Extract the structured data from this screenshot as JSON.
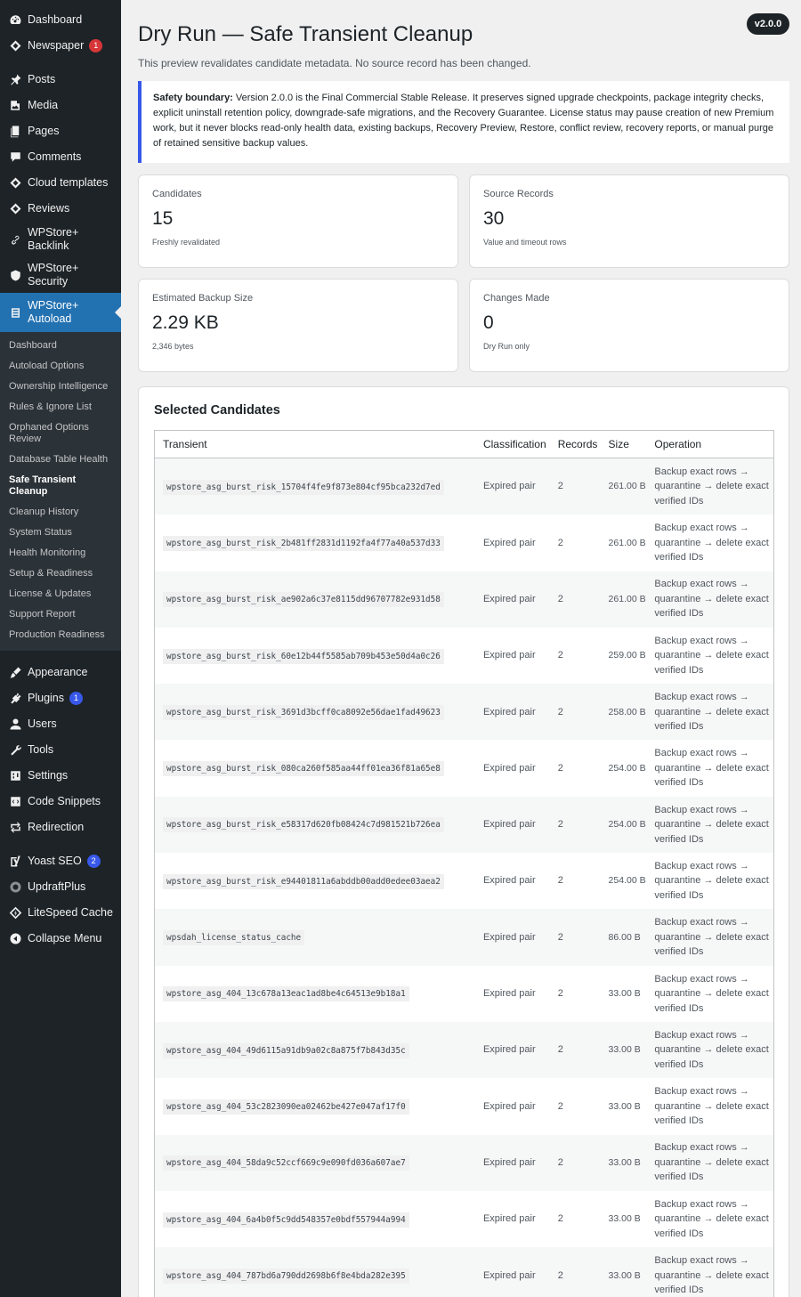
{
  "sidebar": {
    "top_items": [
      {
        "label": "Dashboard",
        "icon": "dashboard-icon"
      },
      {
        "label": "Newspaper",
        "icon": "newspaper-icon",
        "badge": "1"
      }
    ],
    "items": [
      {
        "label": "Posts",
        "icon": "pin-icon"
      },
      {
        "label": "Media",
        "icon": "media-icon"
      },
      {
        "label": "Pages",
        "icon": "pages-icon"
      },
      {
        "label": "Comments",
        "icon": "comments-icon"
      },
      {
        "label": "Cloud templates",
        "icon": "diamond-icon"
      },
      {
        "label": "Reviews",
        "icon": "diamond-icon"
      },
      {
        "label": "WPStore+ Backlink",
        "icon": "link-icon"
      },
      {
        "label": "WPStore+ Security",
        "icon": "shield-icon"
      }
    ],
    "active_item": {
      "label": "WPStore+ Autoload",
      "icon": "database-icon"
    },
    "submenu": [
      "Dashboard",
      "Autoload Options",
      "Ownership Intelligence",
      "Rules & Ignore List",
      "Orphaned Options Review",
      "Database Table Health",
      "Safe Transient Cleanup",
      "Cleanup History",
      "System Status",
      "Health Monitoring",
      "Setup & Readiness",
      "License & Updates",
      "Support Report",
      "Production Readiness"
    ],
    "current_submenu": "Safe Transient Cleanup",
    "bottom_items": [
      {
        "label": "Appearance",
        "icon": "brush-icon"
      },
      {
        "label": "Plugins",
        "icon": "plugin-icon",
        "badge": "1"
      },
      {
        "label": "Users",
        "icon": "user-icon"
      },
      {
        "label": "Tools",
        "icon": "wrench-icon"
      },
      {
        "label": "Settings",
        "icon": "settings-icon"
      },
      {
        "label": "Code Snippets",
        "icon": "code-icon"
      },
      {
        "label": "Redirection",
        "icon": "redirect-icon"
      },
      {
        "label": "Yoast SEO",
        "icon": "yoast-icon",
        "badge": "2"
      },
      {
        "label": "UpdraftPlus",
        "icon": "updraft-icon"
      },
      {
        "label": "LiteSpeed Cache",
        "icon": "litespeed-icon"
      },
      {
        "label": "Collapse Menu",
        "icon": "collapse-icon"
      }
    ]
  },
  "header": {
    "title": "Dry Run — Safe Transient Cleanup",
    "subtitle": "This preview revalidates candidate metadata. No source record has been changed.",
    "version": "v2.0.0"
  },
  "notice": {
    "bold": "Safety boundary:",
    "text": " Version 2.0.0 is the Final Commercial Stable Release. It preserves signed upgrade checkpoints, package integrity checks, explicit uninstall retention policy, downgrade-safe migrations, and the Recovery Guarantee. License status may pause creation of new Premium work, but it never blocks read-only health data, existing backups, Recovery Preview, Restore, conflict review, recovery reports, or manual purge of retained sensitive backup values."
  },
  "stats": [
    {
      "label": "Candidates",
      "value": "15",
      "note": "Freshly revalidated"
    },
    {
      "label": "Source Records",
      "value": "30",
      "note": "Value and timeout rows"
    },
    {
      "label": "Estimated Backup Size",
      "value": "2.29 KB",
      "note": "2,346 bytes"
    },
    {
      "label": "Changes Made",
      "value": "0",
      "note": "Dry Run only"
    }
  ],
  "table": {
    "title": "Selected Candidates",
    "columns": [
      "Transient",
      "Classification",
      "Records",
      "Size",
      "Operation"
    ],
    "rows": [
      {
        "transient": "wpstore_asg_burst_risk_15704f4fe9f873e804cf95bca232d7ed",
        "classification": "Expired pair",
        "records": "2",
        "size": "261.00 B",
        "operation": "Backup exact rows → quarantine → delete exact verified IDs"
      },
      {
        "transient": "wpstore_asg_burst_risk_2b481ff2831d1192fa4f77a40a537d33",
        "classification": "Expired pair",
        "records": "2",
        "size": "261.00 B",
        "operation": "Backup exact rows → quarantine → delete exact verified IDs"
      },
      {
        "transient": "wpstore_asg_burst_risk_ae902a6c37e8115dd96707782e931d58",
        "classification": "Expired pair",
        "records": "2",
        "size": "261.00 B",
        "operation": "Backup exact rows → quarantine → delete exact verified IDs"
      },
      {
        "transient": "wpstore_asg_burst_risk_60e12b44f5585ab709b453e50d4a0c26",
        "classification": "Expired pair",
        "records": "2",
        "size": "259.00 B",
        "operation": "Backup exact rows → quarantine → delete exact verified IDs"
      },
      {
        "transient": "wpstore_asg_burst_risk_3691d3bcff0ca8092e56dae1fad49623",
        "classification": "Expired pair",
        "records": "2",
        "size": "258.00 B",
        "operation": "Backup exact rows → quarantine → delete exact verified IDs"
      },
      {
        "transient": "wpstore_asg_burst_risk_080ca260f585aa44ff01ea36f81a65e8",
        "classification": "Expired pair",
        "records": "2",
        "size": "254.00 B",
        "operation": "Backup exact rows → quarantine → delete exact verified IDs"
      },
      {
        "transient": "wpstore_asg_burst_risk_e58317d620fb08424c7d981521b726ea",
        "classification": "Expired pair",
        "records": "2",
        "size": "254.00 B",
        "operation": "Backup exact rows → quarantine → delete exact verified IDs"
      },
      {
        "transient": "wpstore_asg_burst_risk_e94401811a6abddb00add0edee03aea2",
        "classification": "Expired pair",
        "records": "2",
        "size": "254.00 B",
        "operation": "Backup exact rows → quarantine → delete exact verified IDs"
      },
      {
        "transient": "wpsdah_license_status_cache",
        "classification": "Expired pair",
        "records": "2",
        "size": "86.00 B",
        "operation": "Backup exact rows → quarantine → delete exact verified IDs"
      },
      {
        "transient": "wpstore_asg_404_13c678a13eac1ad8be4c64513e9b18a1",
        "classification": "Expired pair",
        "records": "2",
        "size": "33.00 B",
        "operation": "Backup exact rows → quarantine → delete exact verified IDs"
      },
      {
        "transient": "wpstore_asg_404_49d6115a91db9a02c8a875f7b843d35c",
        "classification": "Expired pair",
        "records": "2",
        "size": "33.00 B",
        "operation": "Backup exact rows → quarantine → delete exact verified IDs"
      },
      {
        "transient": "wpstore_asg_404_53c2823090ea02462be427e047af17f0",
        "classification": "Expired pair",
        "records": "2",
        "size": "33.00 B",
        "operation": "Backup exact rows → quarantine → delete exact verified IDs"
      },
      {
        "transient": "wpstore_asg_404_58da9c52ccf669c9e090fd036a607ae7",
        "classification": "Expired pair",
        "records": "2",
        "size": "33.00 B",
        "operation": "Backup exact rows → quarantine → delete exact verified IDs"
      },
      {
        "transient": "wpstore_asg_404_6a4b0f5c9dd548357e0bdf557944a994",
        "classification": "Expired pair",
        "records": "2",
        "size": "33.00 B",
        "operation": "Backup exact rows → quarantine → delete exact verified IDs"
      },
      {
        "transient": "wpstore_asg_404_787bd6a790dd2698b6f8e4bda282e395",
        "classification": "Expired pair",
        "records": "2",
        "size": "33.00 B",
        "operation": "Backup exact rows → quarantine → delete exact verified IDs"
      }
    ]
  },
  "colors": {
    "sidebar_bg": "#1d2327",
    "accent": "#2271b1",
    "notice_border": "#3858e9"
  }
}
